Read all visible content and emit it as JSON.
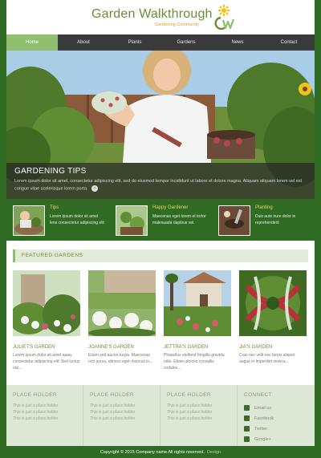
{
  "header": {
    "title": "Garden Walkthrough",
    "tagline": "Gardening Community"
  },
  "nav": {
    "items": [
      {
        "label": "Home",
        "active": true
      },
      {
        "label": "About"
      },
      {
        "label": "Plants"
      },
      {
        "label": "Gardens"
      },
      {
        "label": "News"
      },
      {
        "label": "Contact"
      }
    ]
  },
  "hero": {
    "title": "GARDENING TIPS",
    "text": "Lorem ipsum dolor sit amet, consectetur adipiscing elit, sed do eiusmod tempor incididunt ut labore et dolore magna. Aliquam aliquam lorem vel est congue vitae scelerisque lorem porta."
  },
  "features": [
    {
      "title": "Tips",
      "text": "Lorem ipsum dolor sit amet lens consectetur adipiscing elit"
    },
    {
      "title": "Happy Gardener",
      "text": "Maecenas eget lorem et tortor malesuada dapibus vel."
    },
    {
      "title": "Planting",
      "text": "Duis aute irure dolor in reprehenderit"
    }
  ],
  "featured": {
    "title": "FEATURED GARDENS",
    "gardens": [
      {
        "name": "JULIET'S GARDEN",
        "text": "Lorem ipsum dolor sit amet aaaa, consectetur adipiscing elit. Sed luctus nisi..."
      },
      {
        "name": "JOANNE'S GARDEN",
        "text": "Etiam sed auctor turpis. Maecenas orci purus, ultrices eget rhoncus in..."
      },
      {
        "name": "JETTRA'S GARDEN",
        "text": "Phasellus eleifend fringilla gravida odio. Etiam ultrices convallis sodales..."
      },
      {
        "name": "JIA'S GARDEN",
        "text": "Cras nec velit nec turpis aliquet augue in imperdiet viverra..."
      }
    ]
  },
  "footer": {
    "columns": [
      {
        "title": "PLACE HOLDER",
        "lines": [
          "This is just a place holder",
          "This is just a place holder",
          "This is just a place holder"
        ]
      },
      {
        "title": "PLACE HOLDER",
        "lines": [
          "This is just a place holder",
          "This is just a place holder",
          "This is just a place holder"
        ]
      },
      {
        "title": "PLACE HOLDER",
        "lines": [
          "This is just a place holder",
          "This is just a place holder",
          "This is just a place holder"
        ]
      }
    ],
    "connect": {
      "title": "CONNECT",
      "items": [
        {
          "label": "Email us",
          "icon": "email-icon"
        },
        {
          "label": "Facebook",
          "icon": "facebook-icon"
        },
        {
          "label": "Twitter",
          "icon": "twitter-icon"
        },
        {
          "label": "Google+",
          "icon": "google-plus-icon"
        }
      ]
    }
  },
  "copyright": {
    "text": "Copyright © 2015 Company name All rights reserved.",
    "link": "Design"
  },
  "colors": {
    "brand_green": "#2f6b23",
    "accent_green": "#8fbf6f",
    "title_green": "#6a8c3a",
    "nav_dark": "#3a3a3a"
  }
}
